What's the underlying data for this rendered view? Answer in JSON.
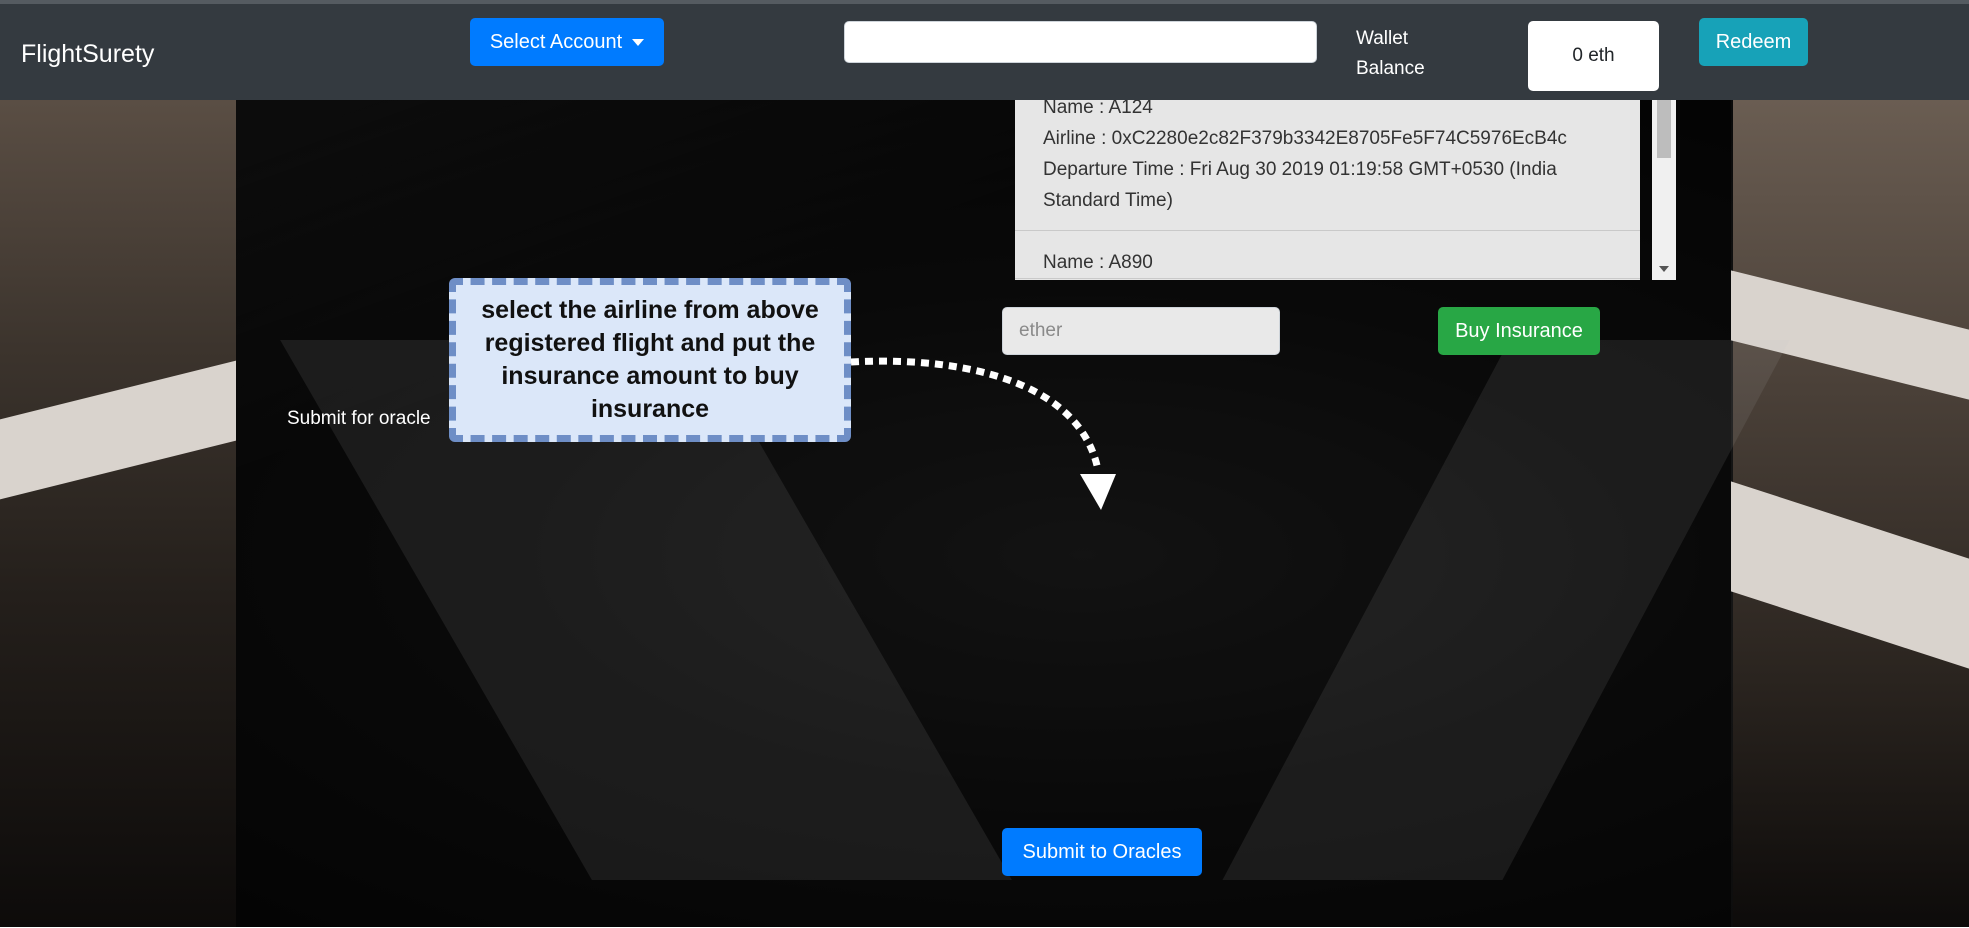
{
  "navbar": {
    "brand": "FlightSurety",
    "select_account_label": "Select Account",
    "search_value": "",
    "wallet_label": "Wallet Balance",
    "balance": "0 eth",
    "redeem_label": "Redeem"
  },
  "flights": [
    {
      "name": "Name : A124",
      "airline": "Airline : 0xC2280e2c82F379b3342E8705Fe5F74C5976EcB4c",
      "departure": "Departure Time : Fri Aug 30 2019 01:19:58 GMT+0530 (India Standard Time)"
    },
    {
      "name": "Name : A890"
    }
  ],
  "insurance": {
    "amount_placeholder": "ether",
    "buy_label": "Buy Insurance"
  },
  "oracle": {
    "label": "Submit for oracle",
    "submit_label": "Submit to Oracles"
  },
  "callout": {
    "text": "select the airline from above registered flight and put the insurance amount to buy insurance"
  },
  "colors": {
    "navbar": "#343a40",
    "primary": "#007bff",
    "info": "#17a2b8",
    "success": "#28a745",
    "callout_fill": "#dbe7f9",
    "callout_border": "#6e8ec6"
  }
}
